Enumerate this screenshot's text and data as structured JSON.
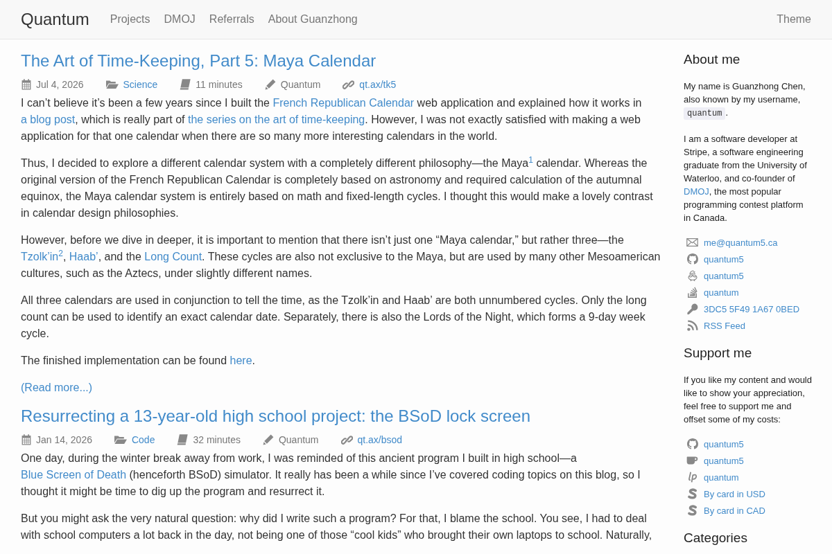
{
  "navbar": {
    "brand": "Quantum",
    "links": [
      "Projects",
      "DMOJ",
      "Referrals",
      "About Guanzhong"
    ],
    "theme": "Theme"
  },
  "posts": [
    {
      "title": "The Art of Time-Keeping, Part 5: Maya Calendar",
      "meta": [
        {
          "kind": "date",
          "text": "Jul 4, 2026"
        },
        {
          "kind": "category",
          "text": "Science"
        },
        {
          "kind": "duration",
          "text": "11 minutes"
        },
        {
          "kind": "author",
          "text": "Quantum"
        },
        {
          "kind": "shortlink",
          "text": "qt.ax/tk5"
        }
      ],
      "paragraphs": [
        [
          {
            "kind": "text",
            "text": "I can’t believe it’s been a few years since I built the "
          },
          {
            "kind": "link",
            "text": "French Republican Calendar"
          },
          {
            "kind": "text",
            "text": " web application and explained how it works in "
          },
          {
            "kind": "link",
            "text": "a blog post"
          },
          {
            "kind": "text",
            "text": ", which is really part of "
          },
          {
            "kind": "link",
            "text": "the series on the art of time-keeping"
          },
          {
            "kind": "text",
            "text": ". However, I was not exactly satisfied with making a web application for that one calendar when there are so many more interesting calendars in the world."
          }
        ],
        [
          {
            "kind": "text",
            "text": "Thus, I decided to explore a different calendar system with a completely different philosophy—the Maya"
          },
          {
            "kind": "footnote",
            "text": "1"
          },
          {
            "kind": "text",
            "text": " calendar. Whereas the original version of the French Republican Calendar is completely based on astronomy and required calculation of the autumnal equinox, the Maya calendar system is entirely based on math and fixed-length cycles. I thought this would make a lovely contrast in calendar design philosophies."
          }
        ],
        [
          {
            "kind": "text",
            "text": "However, before we dive in deeper, it is important to mention that there isn’t just one “Maya calendar,” but rather three—the "
          },
          {
            "kind": "link",
            "text": "Tzolk’in"
          },
          {
            "kind": "footnote",
            "text": "2"
          },
          {
            "kind": "text",
            "text": ", "
          },
          {
            "kind": "link",
            "text": "Haab’"
          },
          {
            "kind": "text",
            "text": ", and the "
          },
          {
            "kind": "link",
            "text": "Long Count"
          },
          {
            "kind": "text",
            "text": ". These cycles are also not exclusive to the Maya, but are used by many other Mesoamerican cultures, such as the Aztecs, under slightly different names."
          }
        ],
        [
          {
            "kind": "text",
            "text": "All three calendars are used in conjunction to tell the time, as the Tzolk’in and Haab’ are both unnumbered cycles. Only the long count can be used to identify an exact calendar date. Separately, there is also the Lords of the Night, which forms a 9-day week cycle."
          }
        ],
        [
          {
            "kind": "text",
            "text": "The finished implementation can be found "
          },
          {
            "kind": "link",
            "text": "here"
          },
          {
            "kind": "text",
            "text": "."
          }
        ]
      ],
      "read_more": "(Read more...)"
    },
    {
      "title": "Resurrecting a 13-year-old high school project: the BSoD lock screen",
      "meta": [
        {
          "kind": "date",
          "text": "Jan 14, 2026"
        },
        {
          "kind": "category",
          "text": "Code"
        },
        {
          "kind": "duration",
          "text": "32 minutes"
        },
        {
          "kind": "author",
          "text": "Quantum"
        },
        {
          "kind": "shortlink",
          "text": "qt.ax/bsod"
        }
      ],
      "paragraphs": [
        [
          {
            "kind": "text",
            "text": "One day, during the winter break away from work, I was reminded of this ancient program I built in high school—a "
          },
          {
            "kind": "link",
            "text": "Blue Screen of Death"
          },
          {
            "kind": "text",
            "text": " (henceforth BSoD) simulator. It really has been a while since I’ve covered coding topics on this blog, so I thought it might be time to dig up the program and resurrect it."
          }
        ],
        [
          {
            "kind": "text",
            "text": "But you might ask the very natural question: why did I write such a program? For that, I blame the school. You see, I had to deal with school computers a lot back in the day, not being one of those “cool kids” who brought their own laptops to school. Naturally,"
          }
        ]
      ]
    }
  ],
  "sidebar": [
    {
      "heading": "About me",
      "paragraphs": [
        [
          {
            "kind": "text",
            "text": "My name is Guanzhong Chen, also known by my username, "
          },
          {
            "kind": "code",
            "text": "quantum"
          },
          {
            "kind": "text",
            "text": "."
          }
        ],
        [
          {
            "kind": "text",
            "text": "I am a software developer at Stripe, a software engineering graduate from the University of Waterloo, and co-founder of "
          },
          {
            "kind": "link",
            "text": "DMOJ"
          },
          {
            "kind": "text",
            "text": ", the most popular programming contest platform in Canada."
          }
        ]
      ],
      "links": [
        {
          "kind": "email",
          "text": "me@quantum5.ca"
        },
        {
          "kind": "github",
          "text": "quantum5"
        },
        {
          "kind": "keybase",
          "text": "quantum5"
        },
        {
          "kind": "stackoverflow",
          "text": "quantum"
        },
        {
          "kind": "pgp",
          "text": "3DC5 5F49 1A67 0BED"
        },
        {
          "kind": "rss",
          "text": "RSS Feed"
        }
      ]
    },
    {
      "heading": "Support me",
      "paragraphs": [
        [
          {
            "kind": "text",
            "text": "If you like my content and would like to show your appreciation, feel free to support me and offset some of my costs:"
          }
        ]
      ],
      "links": [
        {
          "kind": "github",
          "text": "quantum5"
        },
        {
          "kind": "kofi",
          "text": "quantum5"
        },
        {
          "kind": "liberapay",
          "text": "quantum"
        },
        {
          "kind": "stripe",
          "text": "By card in USD"
        },
        {
          "kind": "stripe",
          "text": "By card in CAD"
        }
      ]
    },
    {
      "heading": "Categories"
    }
  ]
}
